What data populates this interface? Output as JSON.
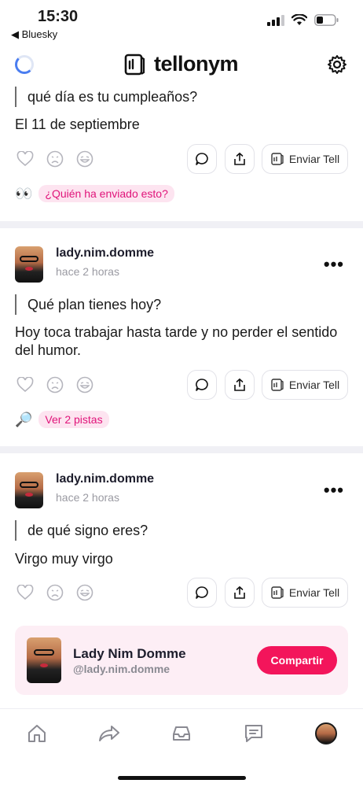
{
  "status_bar": {
    "time": "15:30",
    "back_app": "◀ Bluesky"
  },
  "header": {
    "brand": "tellonym"
  },
  "posts": [
    {
      "question": "qué día es tu cumpleaños?",
      "answer": "El 11 de septiembre",
      "send_label": "Enviar Tell",
      "hint_emoji": "👀",
      "hint": "¿Quién ha enviado esto?"
    },
    {
      "username": "lady.nim.domme",
      "ago": "hace 2 horas",
      "question": "Qué plan tienes hoy?",
      "answer": "Hoy toca trabajar hasta tarde y no perder el sentido del humor.",
      "send_label": "Enviar Tell",
      "hint_emoji": "🔎",
      "hint": "Ver 2 pistas"
    },
    {
      "username": "lady.nim.domme",
      "ago": "hace 2 horas",
      "question": "de qué signo eres?",
      "answer": "Virgo muy virgo",
      "send_label": "Enviar Tell"
    }
  ],
  "share_card": {
    "name": "Lady Nim Domme",
    "handle": "@lady.nim.domme",
    "button": "Compartir"
  },
  "colors": {
    "accent": "#f3155b",
    "pill_bg": "#fde4f0",
    "pill_text": "#e0147a"
  },
  "tabs": [
    "home-icon",
    "share-icon",
    "inbox-icon",
    "messages-icon",
    "profile-avatar"
  ]
}
